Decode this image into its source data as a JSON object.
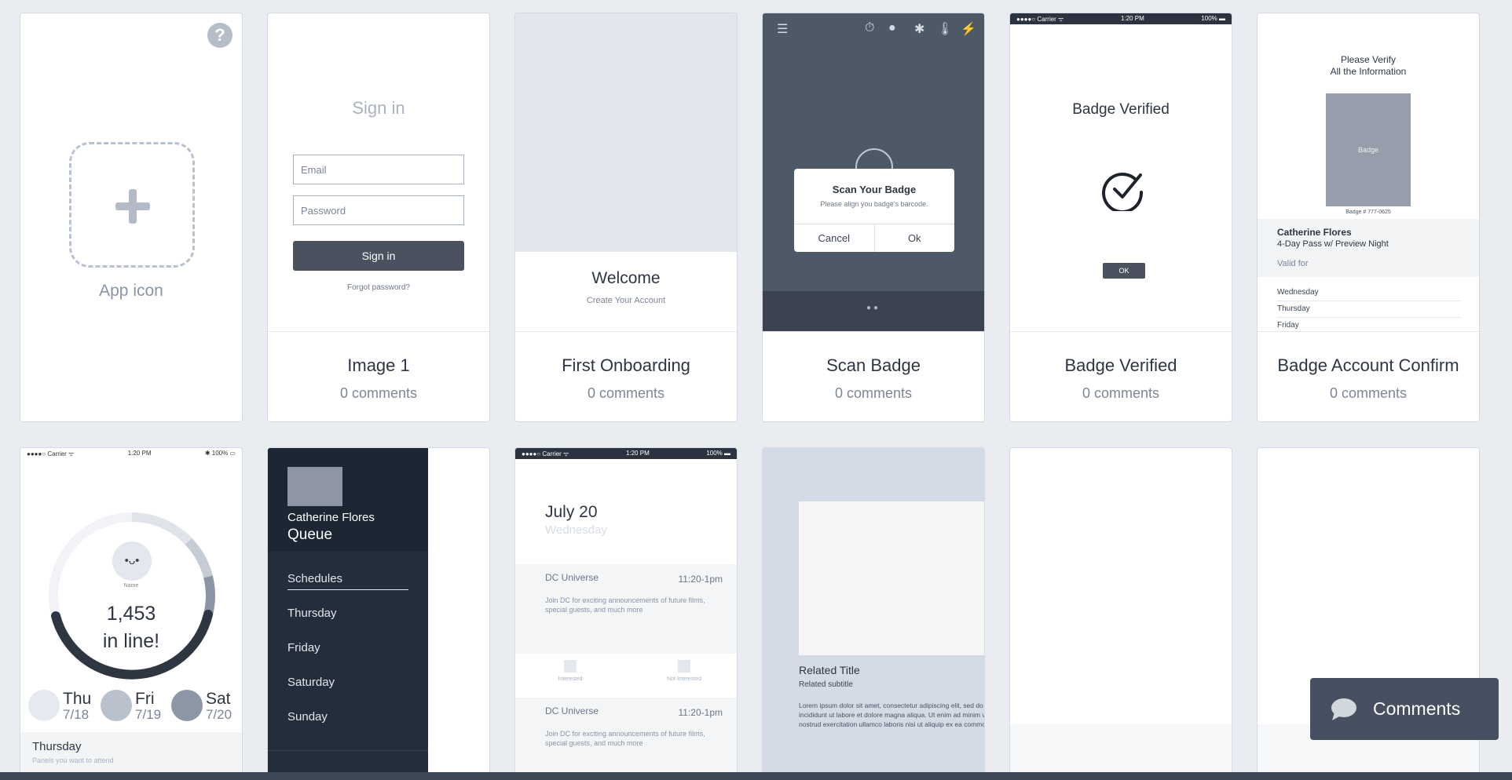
{
  "cards": [
    {
      "label": "App icon",
      "help": "?"
    },
    {
      "title": "Image 1",
      "comments": "0 comments",
      "screen": {
        "heading": "Sign in",
        "email_placeholder": "Email",
        "password_placeholder": "Password",
        "button": "Sign in",
        "forgot": "Forgot password?"
      }
    },
    {
      "title": "First Onboarding",
      "comments": "0 comments",
      "screen": {
        "welcome": "Welcome",
        "create": "Create Your Account"
      }
    },
    {
      "title": "Scan Badge",
      "comments": "0 comments",
      "screen": {
        "dialog_title": "Scan Your Badge",
        "dialog_sub": "Please align you badge's barcode.",
        "cancel": "Cancel",
        "ok": "Ok"
      }
    },
    {
      "title": "Badge Verified",
      "comments": "0 comments",
      "screen": {
        "carrier": "●●●●○ Carrier ᯤ",
        "time": "1:20 PM",
        "battery": "100% ▬",
        "heading": "Badge Verified",
        "ok": "OK"
      }
    },
    {
      "title": "Badge Account Confirm",
      "comments": "0 comments",
      "screen": {
        "verify_line1": "Please Verify",
        "verify_line2": "All the Information",
        "badge": "Badge",
        "badge_no": "Badge # 777-0625",
        "name": "Catherine Flores",
        "pass": "4-Day Pass w/ Preview Night",
        "valid": "Valid for",
        "days": [
          "Wednesday",
          "Thursday",
          "Friday"
        ]
      }
    }
  ],
  "row2": {
    "queue": {
      "carrier": "●●●●○ Carrier ᯤ",
      "time": "1:20 PM",
      "battery": "✱ 100% ▭",
      "face": "•ᴗ•",
      "name": "Name",
      "count": "1,453",
      "inline": "in line!",
      "days": [
        {
          "name": "Thu",
          "date": "7/18"
        },
        {
          "name": "Fri",
          "date": "7/19"
        },
        {
          "name": "Sat",
          "date": "7/20"
        }
      ],
      "footer_title": "Thursday",
      "footer_sub": "Panels you want to attend"
    },
    "drawer": {
      "name": "Catherine Flores",
      "queue": "Queue",
      "items": [
        "Schedules",
        "Thursday",
        "Friday",
        "Saturday",
        "Sunday"
      ]
    },
    "schedule": {
      "carrier": "●●●●○ Carrier ᯤ",
      "time": "1:20 PM",
      "battery": "100% ▬",
      "date": "July 20",
      "weekday": "Wednesday",
      "events": [
        {
          "title": "DC Universe",
          "time": "11:20-1pm",
          "desc": "Join DC for exciting announcements of future films, special guests, and much more"
        },
        {
          "title": "DC Universe",
          "time": "11:20-1pm",
          "desc": "Join DC for exciting announcements of future films, special guests, and much more"
        }
      ],
      "interested": "Interested",
      "not_interested": "Not Interested"
    },
    "related": {
      "title": "Related Title",
      "subtitle": "Related subtitle",
      "body": "Lorem ipsum dolor sit amet, consectetur adipiscing elit, sed do eiusmod tempor incididunt ut labore et dolore magna aliqua. Ut enim ad minim veniam, quis nostrud exercitation ullamco laboris nisi ut aliquip ex ea commodo consequat."
    }
  },
  "comments_button": "Comments",
  "colors": {
    "background": "#e9edf2",
    "dark": "#4a5260",
    "drawer": "#232d3b"
  }
}
